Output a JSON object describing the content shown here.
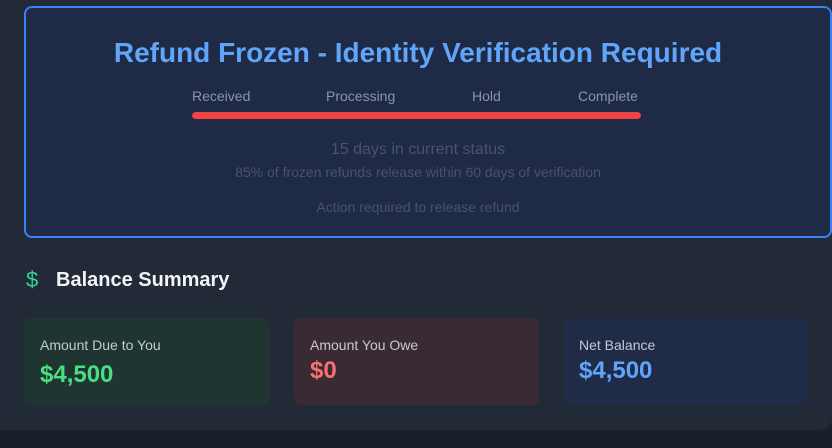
{
  "status_card": {
    "title": "Refund Frozen - Identity Verification Required",
    "stages": [
      "Received",
      "Processing",
      "Hold",
      "Complete"
    ],
    "progress_fraction": 1.0,
    "progress_color": "#ef4444",
    "days_status": "15 days in current status",
    "release_note": "85% of frozen refunds release within 60 days of verification",
    "action_note": "Action required to release refund"
  },
  "balance_summary": {
    "icon": "dollar-icon",
    "title": "Balance Summary",
    "cards": [
      {
        "label": "Amount Due to You",
        "value": "$4,500",
        "color": "#4ade80"
      },
      {
        "label": "Amount You Owe",
        "value": "$0",
        "color": "#f87171"
      },
      {
        "label": "Net Balance",
        "value": "$4,500",
        "color": "#60a5fa"
      }
    ]
  },
  "colors": {
    "accent": "#3b82f6",
    "title": "#60a5fa",
    "positive": "#4ade80",
    "negative": "#f87171"
  }
}
